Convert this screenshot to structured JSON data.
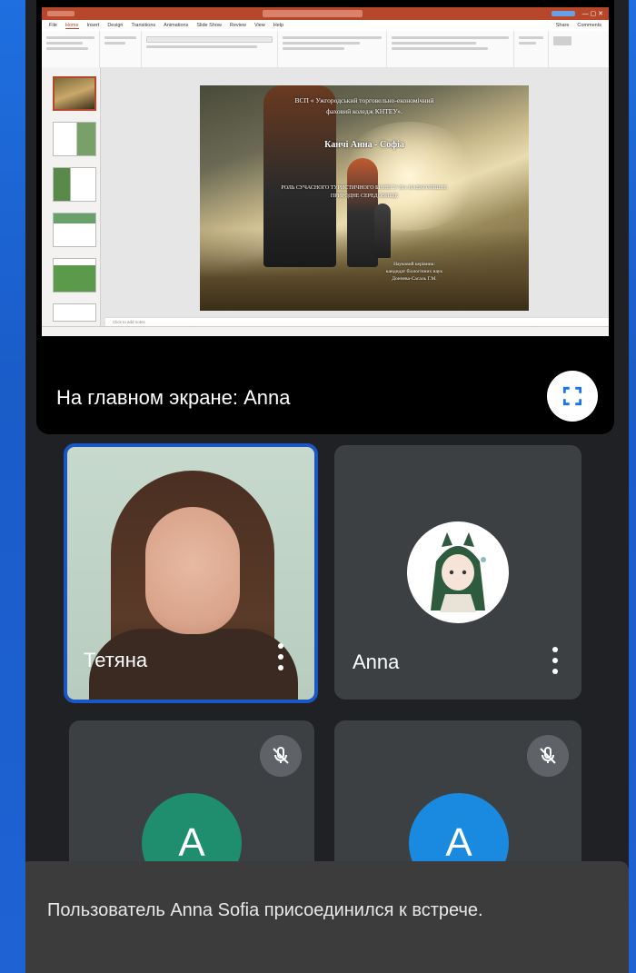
{
  "presentation": {
    "label": "На главном экране: Anna",
    "fullscreen_icon": "fullscreen-icon",
    "ppt": {
      "menu": [
        "File",
        "Home",
        "Insert",
        "Design",
        "Transitions",
        "Animations",
        "Slide Show",
        "Review",
        "View",
        "Help"
      ],
      "share": "Share",
      "comments": "Comments",
      "notes_placeholder": "Click to add notes",
      "slide": {
        "line1": "ВСП « Ужгородський торговельно-економічний",
        "line2": "фаховий коледж КНТЕУ».",
        "author": "Канчі Анна - Софіа",
        "topic1": "РОЛЬ СУЧАСНОГО ТУРИСТИЧНОГО БІЗНЕСУ НА НАВКОЛИШНЄ",
        "topic2": "ПРИРОДНЕ СЕРЕДОВИЩЕ",
        "sup1": "Науковий керівник:",
        "sup2": "кандидат біологічних наук",
        "sup3": "Дончева-Сасаль Г.М."
      }
    }
  },
  "participants": [
    {
      "name": "Тетяна",
      "active": true
    },
    {
      "name": "Anna",
      "avatar": "illustration"
    },
    {
      "initial": "A",
      "color": "#1e8e6e",
      "muted": true
    },
    {
      "initial": "A",
      "color": "#1a8ae0",
      "muted": true
    }
  ],
  "toast": {
    "message": "Пользователь Anna Sofia присоединился к встрече."
  }
}
